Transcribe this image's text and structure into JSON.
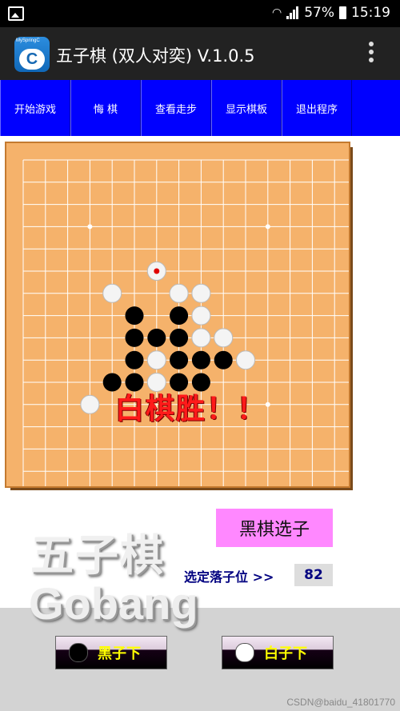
{
  "status_bar": {
    "battery": "57%",
    "time": "15:19"
  },
  "app_bar": {
    "icon_text": "MySpringC",
    "icon_letter": "C",
    "title": "五子棋 (双人对奕) V.1.0.5"
  },
  "menu": [
    "开始游戏",
    "悔  棋",
    "查看走步",
    "显示棋板",
    "退出程序"
  ],
  "board": {
    "size": 15,
    "star_points": [
      [
        3,
        3
      ],
      [
        11,
        3
      ],
      [
        11,
        11
      ],
      [
        3,
        11
      ]
    ],
    "black_stones": [
      [
        5,
        7
      ],
      [
        7,
        7
      ],
      [
        5,
        8
      ],
      [
        6,
        8
      ],
      [
        7,
        8
      ],
      [
        5,
        9
      ],
      [
        7,
        9
      ],
      [
        8,
        9
      ],
      [
        9,
        9
      ],
      [
        4,
        10
      ],
      [
        5,
        10
      ],
      [
        7,
        10
      ],
      [
        8,
        10
      ]
    ],
    "white_stones": [
      [
        4,
        6
      ],
      [
        7,
        6
      ],
      [
        8,
        6
      ],
      [
        8,
        7
      ],
      [
        8,
        8
      ],
      [
        9,
        8
      ],
      [
        6,
        9
      ],
      [
        10,
        9
      ],
      [
        6,
        10
      ],
      [
        3,
        11
      ]
    ],
    "last_move": [
      6,
      5
    ]
  },
  "result_text": "白棋胜！！",
  "selection": {
    "mode": "黑棋选子",
    "label": "选定落子位 >>",
    "value": "82"
  },
  "logo": {
    "line1": "五子棋",
    "line2": "Gobang"
  },
  "buttons": {
    "black": "黑子下",
    "white": "白子下"
  },
  "colors": {
    "menu": "#0000ff",
    "board": "#f5b26b",
    "win": "#ff1a1a",
    "mode_box": "#ff88ff"
  },
  "watermark": "CSDN@baidu_41801770"
}
